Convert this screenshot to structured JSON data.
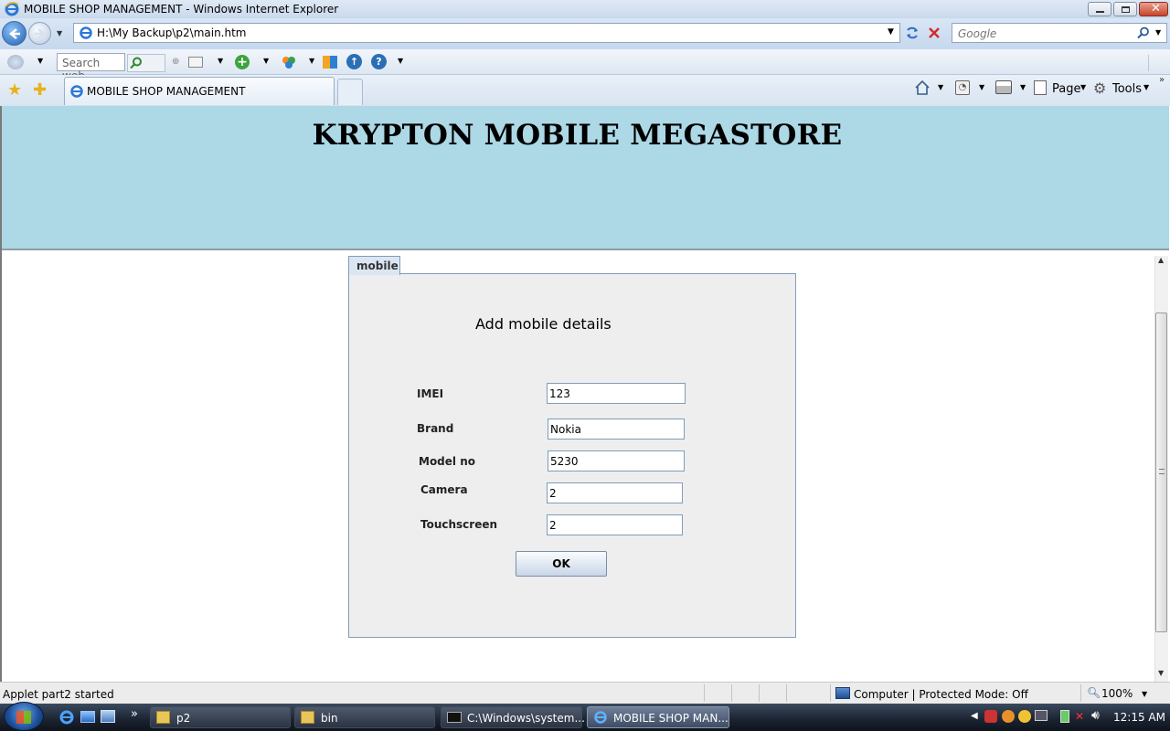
{
  "window": {
    "title": "MOBILE SHOP MANAGEMENT - Windows Internet Explorer"
  },
  "address_bar": {
    "url": "H:\\My Backup\\p2\\main.htm",
    "search_placeholder": "Google"
  },
  "toolbar": {
    "search_placeholder": "Search web..."
  },
  "tabs": [
    {
      "label": "MOBILE SHOP MANAGEMENT"
    }
  ],
  "command_bar": {
    "page_label": "Page",
    "tools_label": "Tools"
  },
  "page": {
    "store_title": "KRYPTON MOBILE MEGASTORE"
  },
  "applet": {
    "tab_label": "mobile",
    "form_title": "Add mobile details",
    "fields": [
      {
        "label": "IMEI",
        "value": "123"
      },
      {
        "label": "Brand",
        "value": "Nokia"
      },
      {
        "label": "Model no",
        "value": "5230"
      },
      {
        "label": "Camera",
        "value": "2"
      },
      {
        "label": "Touchscreen",
        "value": "2"
      }
    ],
    "ok_label": "OK"
  },
  "status_bar": {
    "text": "Applet part2 started",
    "zone": "Computer | Protected Mode: Off",
    "zoom": "100%"
  },
  "taskbar": {
    "items": [
      {
        "label": "p2"
      },
      {
        "label": "bin"
      },
      {
        "label": "C:\\Windows\\system..."
      },
      {
        "label": "MOBILE SHOP MAN..."
      }
    ],
    "clock": "12:15 AM"
  },
  "colors": {
    "banner": "#add8e6",
    "panel": "#eeeeee"
  }
}
